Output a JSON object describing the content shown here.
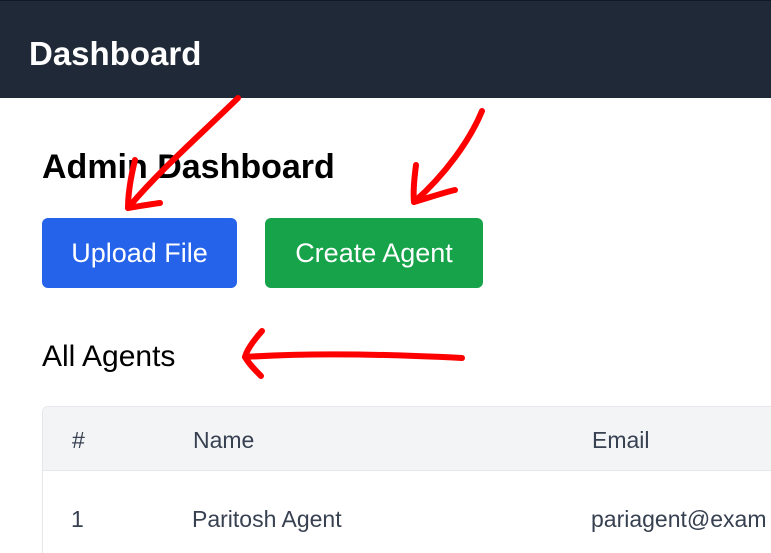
{
  "topbar": {
    "title": "Dashboard"
  },
  "main": {
    "heading": "Admin Dashboard",
    "buttons": {
      "upload_label": "Upload File",
      "create_agent_label": "Create Agent"
    },
    "agents_section_title": "All Agents"
  },
  "agents_table": {
    "columns": [
      "#",
      "Name",
      "Email"
    ],
    "rows": [
      {
        "num": "1",
        "name": "Paritosh Agent",
        "email": "pariagent@exam"
      }
    ]
  },
  "colors": {
    "topbar_bg": "#1f2937",
    "upload_button": "#2563eb",
    "create_agent_button": "#16a34a",
    "annotation_arrows": "#ff0000"
  }
}
